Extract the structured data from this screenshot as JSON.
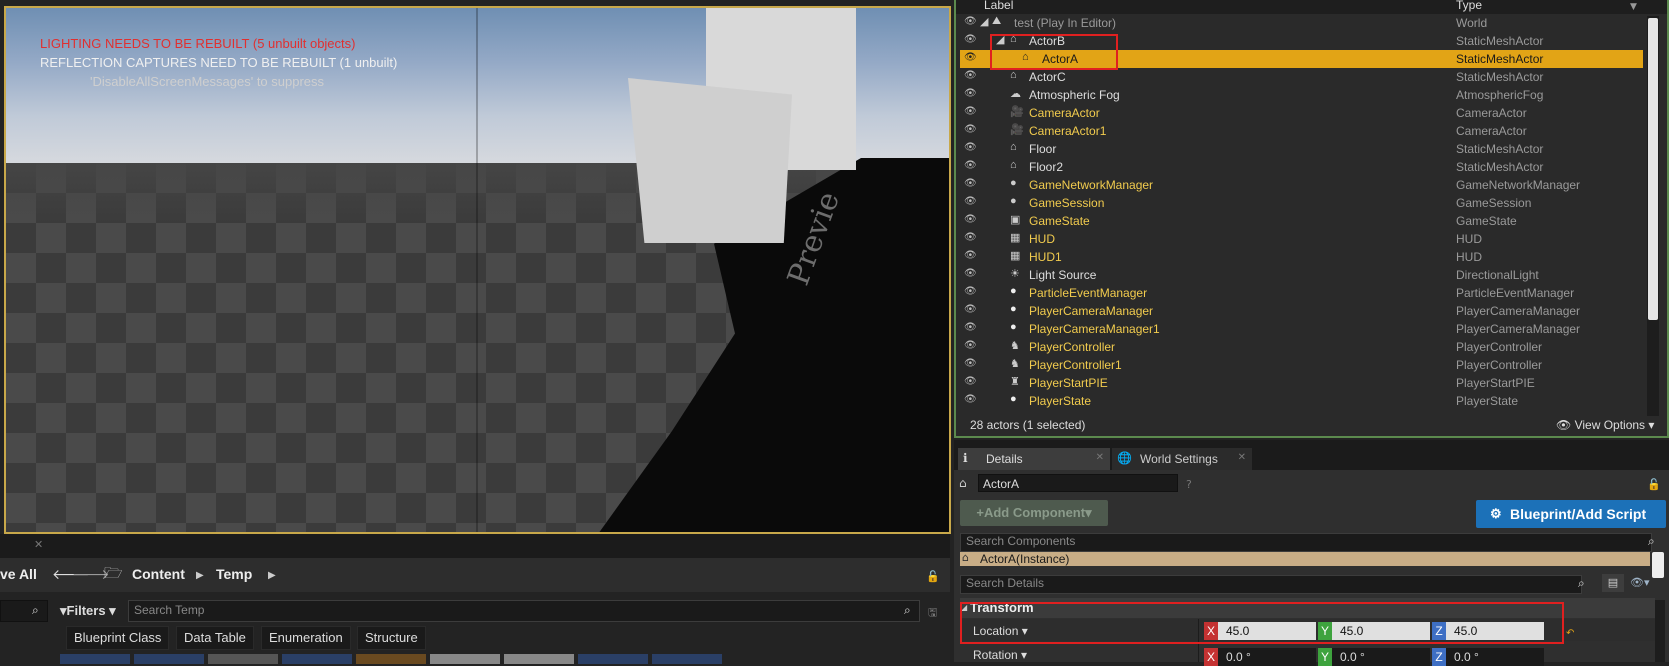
{
  "viewport": {
    "messages": {
      "lighting": "LIGHTING NEEDS TO BE REBUILT (5 unbuilt objects)",
      "reflection": "REFLECTION CAPTURES NEED TO BE REBUILT (1 unbuilt)",
      "suppress": "'DisableAllScreenMessages' to suppress"
    },
    "floor_text": "Previe"
  },
  "content_browser": {
    "save_all": "ve All",
    "breadcrumbs": [
      "Content",
      "Temp"
    ],
    "filters_label": "Filters",
    "search_placeholder": "Search Temp",
    "filter_chips": [
      "Blueprint Class",
      "Data Table",
      "Enumeration",
      "Structure"
    ]
  },
  "outliner": {
    "columns": {
      "label": "Label",
      "type": "Type"
    },
    "rows": [
      {
        "label": "test (Play In Editor)",
        "type": "World"
      },
      {
        "label": "ActorB",
        "type": "StaticMeshActor"
      },
      {
        "label": "ActorA",
        "type": "StaticMeshActor"
      },
      {
        "label": "ActorC",
        "type": "StaticMeshActor"
      },
      {
        "label": "Atmospheric Fog",
        "type": "AtmosphericFog"
      },
      {
        "label": "CameraActor",
        "type": "CameraActor"
      },
      {
        "label": "CameraActor1",
        "type": "CameraActor"
      },
      {
        "label": "Floor",
        "type": "StaticMeshActor"
      },
      {
        "label": "Floor2",
        "type": "StaticMeshActor"
      },
      {
        "label": "GameNetworkManager",
        "type": "GameNetworkManager"
      },
      {
        "label": "GameSession",
        "type": "GameSession"
      },
      {
        "label": "GameState",
        "type": "GameState"
      },
      {
        "label": "HUD",
        "type": "HUD"
      },
      {
        "label": "HUD1",
        "type": "HUD"
      },
      {
        "label": "Light Source",
        "type": "DirectionalLight"
      },
      {
        "label": "ParticleEventManager",
        "type": "ParticleEventManager"
      },
      {
        "label": "PlayerCameraManager",
        "type": "PlayerCameraManager"
      },
      {
        "label": "PlayerCameraManager1",
        "type": "PlayerCameraManager"
      },
      {
        "label": "PlayerController",
        "type": "PlayerController"
      },
      {
        "label": "PlayerController1",
        "type": "PlayerController"
      },
      {
        "label": "PlayerStartPIE",
        "type": "PlayerStartPIE"
      },
      {
        "label": "PlayerState",
        "type": "PlayerState"
      }
    ],
    "status": "28 actors (1 selected)",
    "view_options": "View Options"
  },
  "details": {
    "tabs": [
      "Details",
      "World Settings"
    ],
    "actor_name": "ActorA",
    "add_component": "+Add Component",
    "blueprint_button": "Blueprint/Add Script",
    "search_components_placeholder": "Search Components",
    "instance_label": "ActorA(Instance)",
    "search_details_placeholder": "Search Details",
    "transform_section": "Transform",
    "location_label": "Location",
    "rotation_label": "Rotation",
    "location": {
      "x": "45.0",
      "y": "45.0",
      "z": "45.0"
    },
    "rotation": {
      "x": "0.0 °",
      "y": "0.0 °",
      "z": "0.0 °"
    },
    "axis_letters": {
      "x": "X",
      "y": "Y",
      "z": "Z"
    }
  },
  "colors": {
    "selection": "#e2a416",
    "actor_label": "#f2cc4e",
    "highlight_box": "#e02020",
    "primary_button": "#1c71b8"
  }
}
